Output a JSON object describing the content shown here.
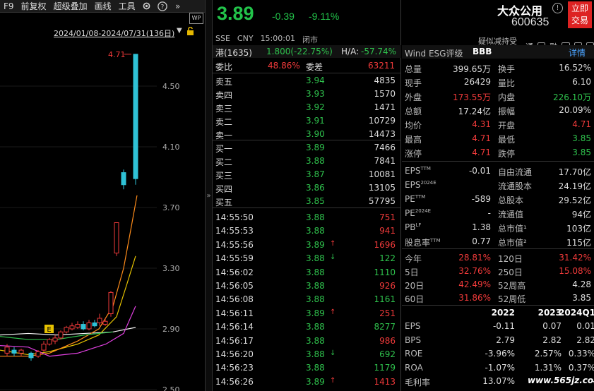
{
  "toolbar": {
    "items": [
      "F9",
      "前复权",
      "超级叠加",
      "画线",
      "工具"
    ]
  },
  "chart": {
    "date_range": "2024/01/08-2024/07/31(136日)",
    "last_label": "4.71",
    "price_labels": [
      "4.50",
      "4.10",
      "3.70",
      "3.30",
      "2.90",
      "2.50"
    ],
    "marker": "E"
  },
  "side_toggle": "»",
  "quote": {
    "price": "3.89",
    "change": "-0.39",
    "pct": "-9.11%",
    "exchange": "SSE",
    "currency": "CNY",
    "time": "15:00:01",
    "status": "闭市"
  },
  "hk": {
    "label": "港(1635)",
    "value": "1.800(-22.75%)",
    "ha_label": "H/A:",
    "ha_value": "-57.74%"
  },
  "committee": {
    "ratio_label": "委比",
    "ratio": "48.86%",
    "diff_label": "委差",
    "diff": "63211"
  },
  "sells": [
    {
      "label": "卖五",
      "price": "3.94",
      "vol": "4835"
    },
    {
      "label": "卖四",
      "price": "3.93",
      "vol": "1570"
    },
    {
      "label": "卖三",
      "price": "3.92",
      "vol": "1471"
    },
    {
      "label": "卖二",
      "price": "3.91",
      "vol": "10729"
    },
    {
      "label": "卖一",
      "price": "3.90",
      "vol": "14473"
    }
  ],
  "buys": [
    {
      "label": "买一",
      "price": "3.89",
      "vol": "7466"
    },
    {
      "label": "买二",
      "price": "3.88",
      "vol": "7841"
    },
    {
      "label": "买三",
      "price": "3.87",
      "vol": "10081"
    },
    {
      "label": "买四",
      "price": "3.86",
      "vol": "13105"
    },
    {
      "label": "买五",
      "price": "3.85",
      "vol": "57795"
    }
  ],
  "ticks": [
    {
      "t": "14:55:50",
      "p": "3.88",
      "v": "751",
      "a": ""
    },
    {
      "t": "14:55:53",
      "p": "3.88",
      "v": "941",
      "a": ""
    },
    {
      "t": "14:55:56",
      "p": "3.89",
      "v": "1696",
      "a": "↑"
    },
    {
      "t": "14:55:59",
      "p": "3.88",
      "v": "122",
      "a": "↓"
    },
    {
      "t": "14:56:02",
      "p": "3.88",
      "v": "1110",
      "a": ""
    },
    {
      "t": "14:56:05",
      "p": "3.88",
      "v": "926",
      "a": ""
    },
    {
      "t": "14:56:08",
      "p": "3.88",
      "v": "1161",
      "a": ""
    },
    {
      "t": "14:56:11",
      "p": "3.89",
      "v": "251",
      "a": "↑"
    },
    {
      "t": "14:56:14",
      "p": "3.88",
      "v": "8277",
      "a": ""
    },
    {
      "t": "14:56:17",
      "p": "3.88",
      "v": "986",
      "a": ""
    },
    {
      "t": "14:56:20",
      "p": "3.88",
      "v": "692",
      "a": "↓"
    },
    {
      "t": "14:56:23",
      "p": "3.88",
      "v": "1179",
      "a": ""
    },
    {
      "t": "14:56:26",
      "p": "3.89",
      "v": "1413",
      "a": "↑"
    }
  ],
  "stock": {
    "name": "大众公用",
    "code": "600635",
    "trade": [
      "立即",
      "交易"
    ],
    "tags": "疑似减持受限",
    "tag2": "通",
    "tag3": "融"
  },
  "wind": {
    "label": "Wind ESG评级",
    "rating": "BBB",
    "detail": "详情"
  },
  "stats": [
    {
      "l1": "总量",
      "v1": "399.65万",
      "l2": "换手",
      "v2": "16.52%"
    },
    {
      "l1": "现手",
      "v1": "26429",
      "l2": "量比",
      "v2": "6.10"
    },
    {
      "l1": "外盘",
      "v1": "173.55万",
      "l2": "内盘",
      "v2": "226.10万"
    },
    {
      "l1": "总额",
      "v1": "17.24亿",
      "l2": "振幅",
      "v2": "20.09%"
    },
    {
      "l1": "均价",
      "v1": "4.31",
      "l2": "开盘",
      "v2": "4.71"
    },
    {
      "l1": "最高",
      "v1": "4.71",
      "l2": "最低",
      "v2": "3.85"
    },
    {
      "l1": "涨停",
      "v1": "4.71",
      "l2": "跌停",
      "v2": "3.85"
    }
  ],
  "fund": [
    {
      "l1": "EPS",
      "s1": "TTM",
      "v1": "-0.01",
      "l2": "自由流通",
      "v2": "17.70亿"
    },
    {
      "l1": "EPS",
      "s1": "2024E",
      "v1": "",
      "l2": "流通股本",
      "v2": "24.19亿"
    },
    {
      "l1": "PE",
      "s1": "TTM",
      "v1": "-589",
      "l2": "总股本",
      "v2": "29.52亿"
    },
    {
      "l1": "PE",
      "s1": "2024E",
      "v1": "-",
      "l2": "流通值",
      "v2": "94亿"
    },
    {
      "l1": "PB",
      "s1": "LF",
      "v1": "1.38",
      "l2": "总市值¹",
      "v2": "103亿"
    },
    {
      "l1": "股息率",
      "s1": "TTM",
      "v1": "0.77",
      "l2": "总市值²",
      "v2": "115亿"
    }
  ],
  "perf": [
    {
      "l1": "今年",
      "v1": "28.81%",
      "l2": "120日",
      "v2": "31.42%"
    },
    {
      "l1": "5日",
      "v1": "32.76%",
      "l2": "250日",
      "v2": "15.08%"
    },
    {
      "l1": "20日",
      "v1": "42.49%",
      "l2": "52周高",
      "v2": "4.28"
    },
    {
      "l1": "60日",
      "v1": "31.86%",
      "l2": "52周低",
      "v2": "3.85"
    }
  ],
  "fin": {
    "years": [
      "2022",
      "2023",
      "2024Q1"
    ],
    "rows": [
      {
        "l": "EPS",
        "v": [
          "-0.11",
          "0.07",
          "0.01"
        ]
      },
      {
        "l": "BPS",
        "v": [
          "2.79",
          "2.82",
          "2.82"
        ]
      },
      {
        "l": "ROE",
        "v": [
          "-3.96%",
          "2.57%",
          "0.33%"
        ]
      },
      {
        "l": "ROA",
        "v": [
          "-1.07%",
          "1.31%",
          "0.37%"
        ]
      },
      {
        "l": "毛利率",
        "v": [
          "13.07%",
          "",
          "-"
        ]
      }
    ]
  },
  "watermark": "www.565jz.com",
  "colors": {
    "up": "#f03a3a",
    "down": "#2fc24d",
    "bg": "#000000"
  }
}
